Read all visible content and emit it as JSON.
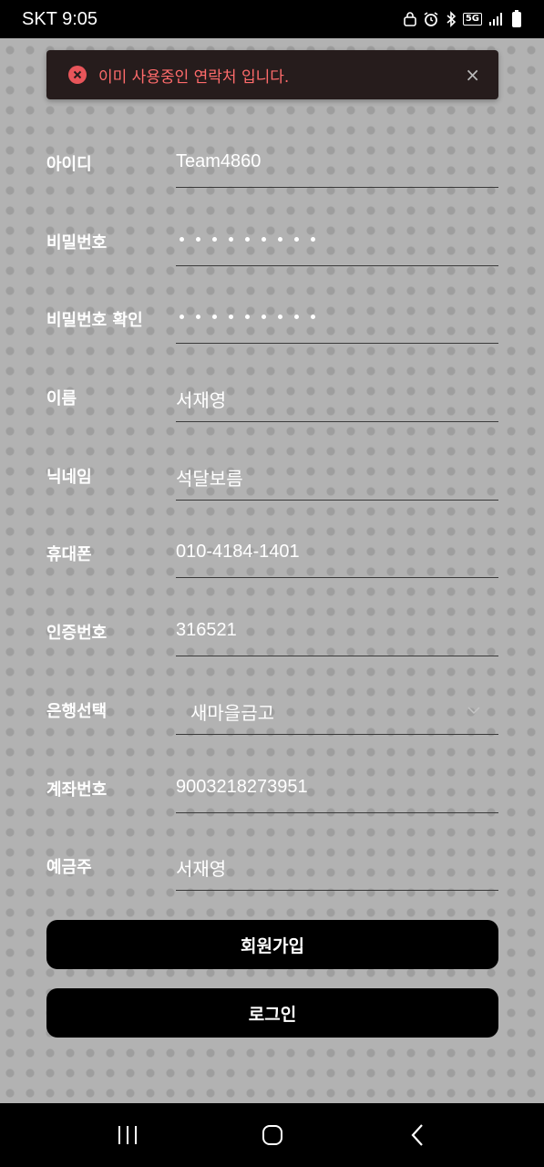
{
  "status_bar": {
    "carrier_time": "SKT 9:05",
    "network": "5G"
  },
  "toast": {
    "message": "이미 사용중인 연락처 입니다.",
    "close": "×",
    "color": "#ff6b6b"
  },
  "form": {
    "id_label": "아이디",
    "id_value": "Team4860",
    "pw_label": "비밀번호",
    "pw_confirm_label": "비밀번호 확인",
    "name_label": "이름",
    "name_value": "서재영",
    "nickname_label": "닉네임",
    "nickname_value": "석달보름",
    "phone_label": "휴대폰",
    "phone_value": "010-4184-1401",
    "auth_label": "인증번호",
    "auth_value": "316521",
    "bank_label": "은행선택",
    "bank_value": "새마을금고",
    "account_label": "계좌번호",
    "account_value": "9003218273951",
    "holder_label": "예금주",
    "holder_value": "서재영"
  },
  "buttons": {
    "signup": "회원가입",
    "login": "로그인"
  }
}
